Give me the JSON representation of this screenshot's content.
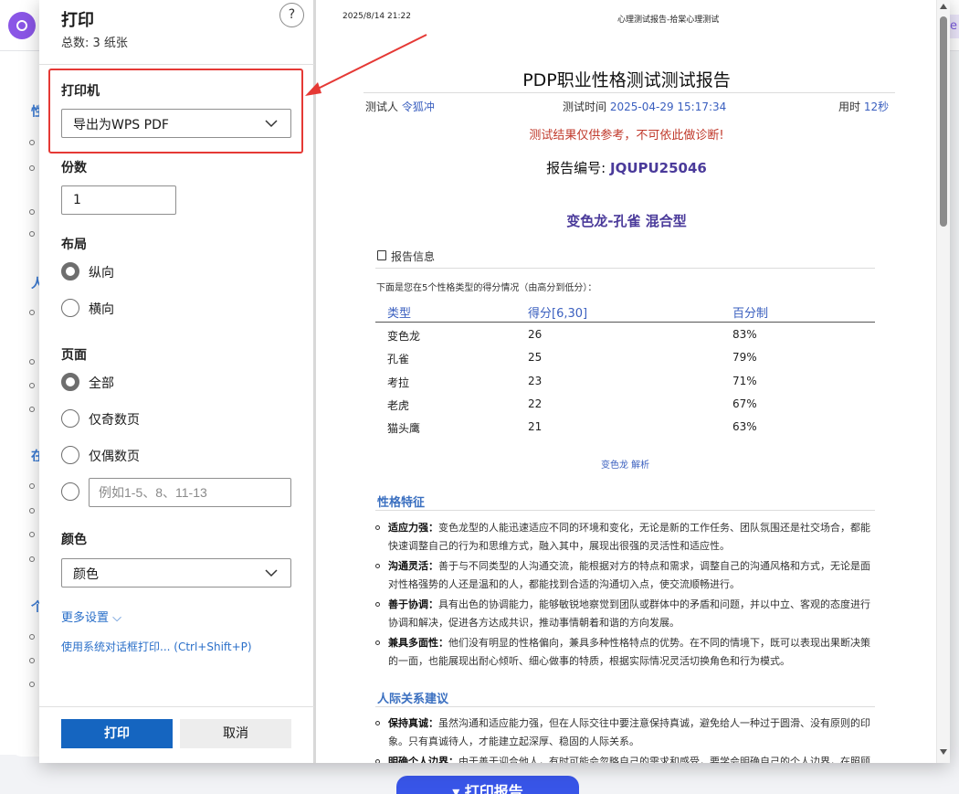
{
  "background": {
    "print_report_button": "▾ 打印报告"
  },
  "dialog": {
    "title": "打印",
    "total": "总数: 3 纸张",
    "help": "?",
    "printer": {
      "label": "打印机",
      "value": "导出为WPS PDF"
    },
    "copies": {
      "label": "份数",
      "value": "1"
    },
    "layout": {
      "label": "布局",
      "options": [
        {
          "label": "纵向",
          "checked": true
        },
        {
          "label": "横向",
          "checked": false
        }
      ]
    },
    "pages": {
      "label": "页面",
      "options": [
        {
          "label": "全部",
          "checked": true
        },
        {
          "label": "仅奇数页",
          "checked": false
        },
        {
          "label": "仅偶数页",
          "checked": false
        }
      ],
      "range_placeholder": "例如1-5、8、11-13"
    },
    "color": {
      "label": "颜色",
      "value": "颜色"
    },
    "more_settings": "更多设置 ⌵",
    "system_dialog": "使用系统对话框打印... (Ctrl+Shift+P)",
    "print_button": "打印",
    "cancel_button": "取消"
  },
  "preview": {
    "header_date": "2025/8/14 21:22",
    "header_title": "心理测试报告-拾棠心理测试",
    "title": "PDP职业性格测试测试报告",
    "tester_label": "测试人",
    "tester_value": "令狐冲",
    "time_label": "测试时间",
    "time_value": "2025-04-29 15:17:34",
    "duration_label": "用时",
    "duration_value": "12秒",
    "warning": "测试结果仅供参考，不可依此做诊断!",
    "code_label": "报告编号:",
    "code_value": "JQUPU25046",
    "result_type": "变色龙-孔雀 混合型",
    "section_info": "报告信息",
    "intro": "下面是您在5个性格类型的得分情况（由高分到低分）：",
    "table": {
      "headers": [
        "类型",
        "得分[6,30]",
        "百分制"
      ],
      "rows": [
        [
          "变色龙",
          "26",
          "83%"
        ],
        [
          "孔雀",
          "25",
          "79%"
        ],
        [
          "考拉",
          "23",
          "71%"
        ],
        [
          "老虎",
          "22",
          "67%"
        ],
        [
          "猫头鹰",
          "21",
          "63%"
        ]
      ]
    },
    "analysis_link": "变色龙 解析",
    "trait_heading": "性格特征",
    "traits": [
      {
        "title": "适应力强：",
        "text": "变色龙型的人能迅速适应不同的环境和变化，无论是新的工作任务、团队氛围还是社交场合，都能快速调整自己的行为和思维方式，融入其中，展现出很强的灵活性和适应性。"
      },
      {
        "title": "沟通灵活：",
        "text": "善于与不同类型的人沟通交流，能根据对方的特点和需求，调整自己的沟通风格和方式，无论是面对性格强势的人还是温和的人，都能找到合适的沟通切入点，使交流顺畅进行。"
      },
      {
        "title": "善于协调：",
        "text": "具有出色的协调能力，能够敏锐地察觉到团队或群体中的矛盾和问题，并以中立、客观的态度进行协调和解决，促进各方达成共识，推动事情朝着和谐的方向发展。"
      },
      {
        "title": "兼具多面性：",
        "text": "他们没有明显的性格偏向，兼具多种性格特点的优势。在不同的情境下，既可以表现出果断决策的一面，也能展现出耐心倾听、细心做事的特质，根据实际情况灵活切换角色和行为模式。"
      }
    ],
    "relation_heading": "人际关系建议",
    "relations": [
      {
        "title": "保持真诚：",
        "text": "虽然沟通和适应能力强，但在人际交往中要注意保持真诚，避免给人一种过于圆滑、没有原则的印象。只有真诚待人，才能建立起深厚、稳固的人际关系。"
      },
      {
        "title": "明确个人边界：",
        "text": "由于善于迎合他人，有时可能会忽略自己的需求和感受，要学会明确自己的个人边界，在照顾"
      }
    ]
  }
}
